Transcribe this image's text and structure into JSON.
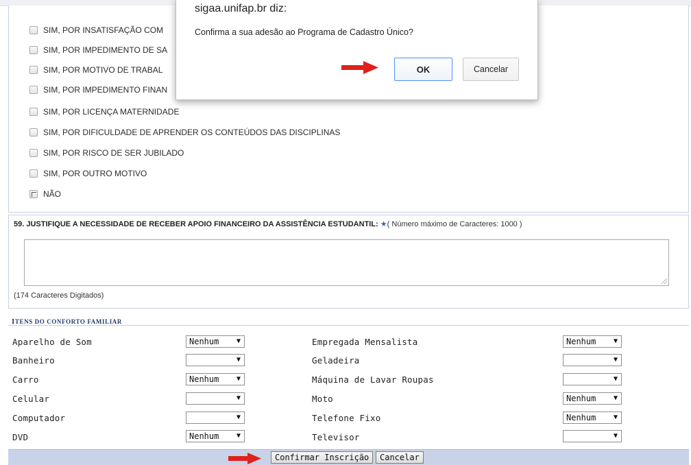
{
  "options": [
    {
      "label": "SIM, POR INSATISFAÇÃO COM"
    },
    {
      "label": "SIM, POR IMPEDIMENTO DE SA"
    },
    {
      "label": "SIM, POR MOTIVO DE TRABAL"
    },
    {
      "label": "SIM, POR IMPEDIMENTO FINAN"
    },
    {
      "label": "SIM, POR LICENÇA MATERNIDADE"
    },
    {
      "label": "SIM, POR DIFICULDADE DE APRENDER OS CONTEÚDOS DAS DISCIPLINAS"
    },
    {
      "label": "SIM, POR RISCO DE SER JUBILADO"
    },
    {
      "label": "SIM, POR OUTRO MOTIVO"
    },
    {
      "label": "NÃO"
    }
  ],
  "question59": {
    "title": "59. JUSTIFIQUE A NECESSIDADE DE RECEBER APOIO FINANCEIRO DA ASSISTÊNCIA ESTUDANTIL:",
    "star": "★",
    "max_note": "( Número máximo de Caracteres: 1000 )",
    "answer": "",
    "count": "(174 Caracteres Digitados)"
  },
  "comfort": {
    "section_title_first": "I",
    "section_title_rest": "TENS DO CONFORTO FAMILIAR",
    "arrow_glyph": "▼",
    "left": [
      {
        "label": "Aparelho de Som",
        "value": "Nenhum"
      },
      {
        "label": "Banheiro",
        "value": ""
      },
      {
        "label": "Carro",
        "value": "Nenhum"
      },
      {
        "label": "Celular",
        "value": ""
      },
      {
        "label": "Computador",
        "value": ""
      },
      {
        "label": "DVD",
        "value": "Nenhum"
      }
    ],
    "right": [
      {
        "label": "Empregada Mensalista",
        "value": "Nenhum"
      },
      {
        "label": "Geladeira",
        "value": ""
      },
      {
        "label": "Máquina de Lavar Roupas",
        "value": ""
      },
      {
        "label": "Moto",
        "value": "Nenhum"
      },
      {
        "label": "Telefone Fixo",
        "value": "Nenhum"
      },
      {
        "label": "Televisor",
        "value": ""
      }
    ]
  },
  "footer": {
    "confirm_label": "Confirmar Inscrição",
    "cancel_label": "Cancelar"
  },
  "dialog": {
    "title": "sigaa.unifap.br diz:",
    "message": "Confirma a sua adesão ao Programa de Cadastro Único?",
    "ok_label": "OK",
    "cancel_label": "Cancelar"
  },
  "colors": {
    "arrow": "#e0201b",
    "footer_bg": "#c8d3e8",
    "section_title": "#223a6d",
    "ok_border": "#4d90fe"
  }
}
